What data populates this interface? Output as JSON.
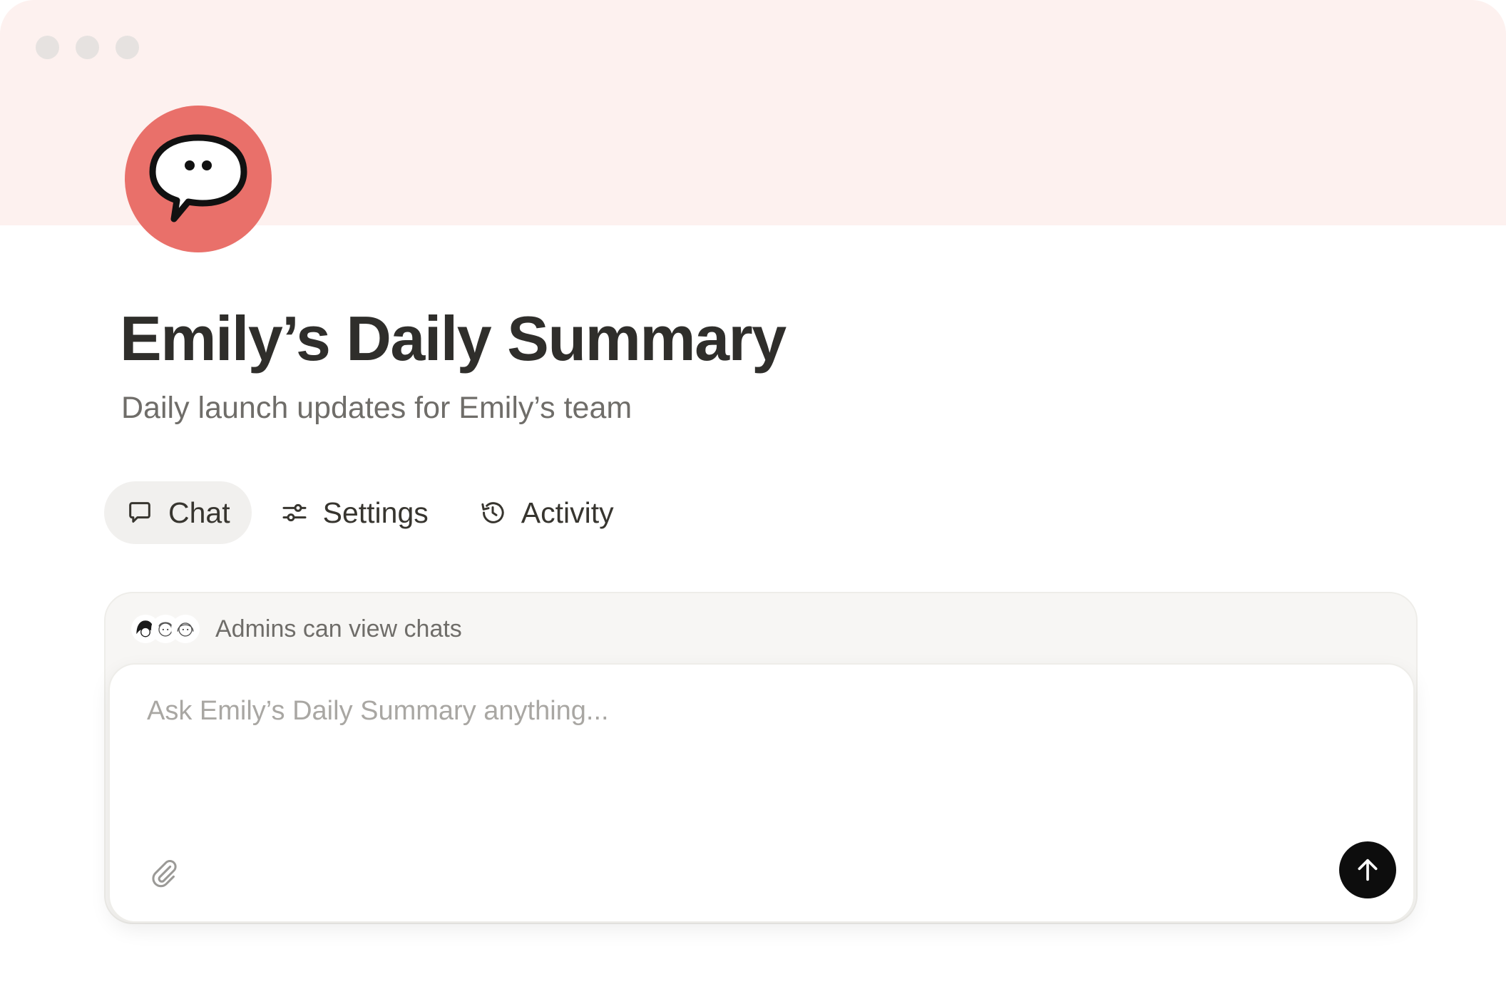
{
  "window": {
    "controls": [
      "close",
      "minimize",
      "maximize"
    ]
  },
  "colors": {
    "cover": "#fdf1ef",
    "avatar": "#e9706a",
    "active_tab": "#f1f0ee",
    "send_button": "#0d0d0d"
  },
  "agent": {
    "avatar_icon": "speech-bubble-face-icon",
    "title": "Emily’s Daily Summary",
    "subtitle": "Daily launch updates for Emily’s team"
  },
  "tabs": [
    {
      "label": "Chat",
      "icon": "chat-bubble-icon",
      "active": true
    },
    {
      "label": "Settings",
      "icon": "sliders-icon",
      "active": false
    },
    {
      "label": "Activity",
      "icon": "history-clock-icon",
      "active": false
    }
  ],
  "chat": {
    "admins_notice": "Admins can view chats",
    "admin_avatars": [
      "admin-avatar-1",
      "admin-avatar-2",
      "admin-avatar-3"
    ],
    "input_value": "",
    "input_placeholder": "Ask Emily’s Daily Summary anything...",
    "attach_icon": "paperclip-icon",
    "send_icon": "arrow-up-icon"
  }
}
